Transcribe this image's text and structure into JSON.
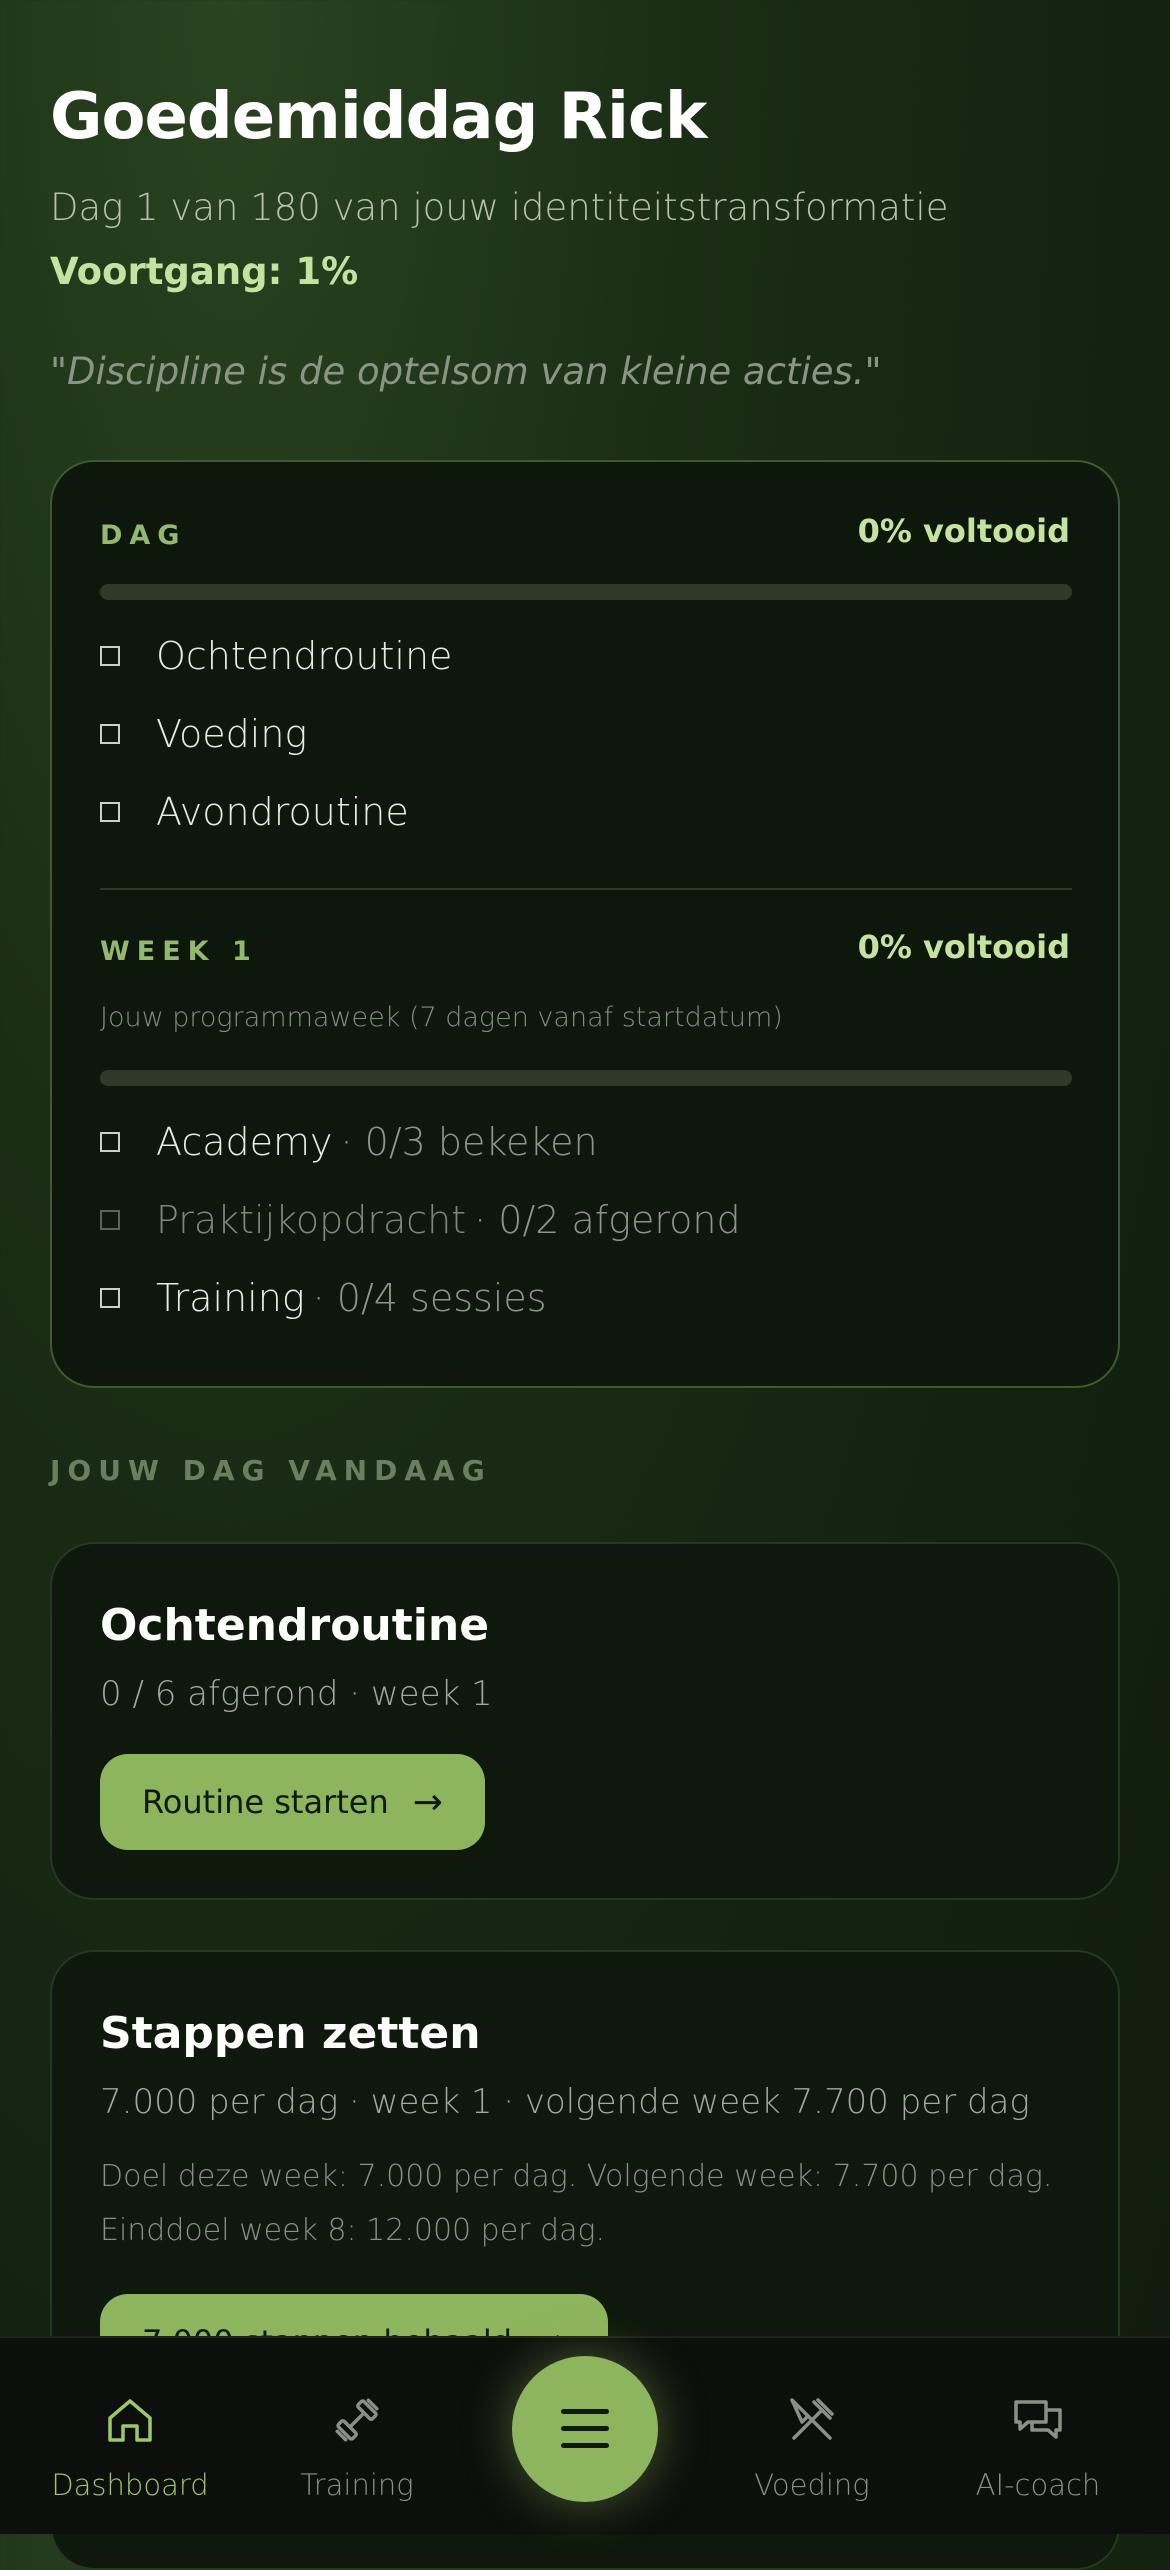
{
  "header": {
    "greeting": "Goedemiddag Rick",
    "subtitle": "Dag 1 van 180 van jouw identiteitstransformatie",
    "progress": "Voortgang: 1%",
    "progress_value": 0.01,
    "quote": "\"Discipline is de optelsom van kleine acties.\""
  },
  "day_card": {
    "heading": "DAG",
    "percent_label": "0% voltooid",
    "progress_value": 0,
    "items": [
      {
        "label": "Ochtendroutine",
        "checked": false
      },
      {
        "label": "Voeding",
        "checked": false
      },
      {
        "label": "Avondroutine",
        "checked": false
      }
    ]
  },
  "week_card": {
    "heading": "WEEK 1",
    "percent_label": "0% voltooid",
    "note": "Jouw programmaweek (7 dagen vanaf startdatum)",
    "progress_value": 0,
    "items": [
      {
        "label": "Academy",
        "meta": "· 0/3 bekeken",
        "checked": false
      },
      {
        "label": "Praktijkopdracht",
        "meta": "· 0/2 afgerond",
        "checked": false,
        "dimmed": true
      },
      {
        "label": "Training",
        "meta": "· 0/4 sessies",
        "checked": false
      }
    ]
  },
  "today": {
    "section_label": "JOUW DAG VANDAAG",
    "morning": {
      "title": "Ochtendroutine",
      "subtitle": "0 / 6 afgerond · week 1",
      "button": "Routine starten"
    },
    "steps": {
      "title": "Stappen zetten",
      "subtitle": "7.000 per dag · week 1 · volgende week 7.700 per dag",
      "description": "Doel deze week: 7.000 per dag. Volgende week: 7.700 per dag. Einddoel week 8: 12.000 per dag.",
      "button": "7.000 stappen behaald"
    }
  },
  "bottom_nav": {
    "items": [
      {
        "label": "Dashboard",
        "icon": "home-icon",
        "active": true
      },
      {
        "label": "Training",
        "icon": "dumbbell-icon",
        "active": false
      },
      {
        "label": "Voeding",
        "icon": "fork-knife-icon",
        "active": false
      },
      {
        "label": "AI-coach",
        "icon": "chat-bubbles-icon",
        "active": false
      }
    ],
    "center_button_icon": "menu-icon"
  },
  "colors": {
    "accent": "#8db55e",
    "accent_text": "#c5e3a0",
    "background": "#1a2d15"
  }
}
